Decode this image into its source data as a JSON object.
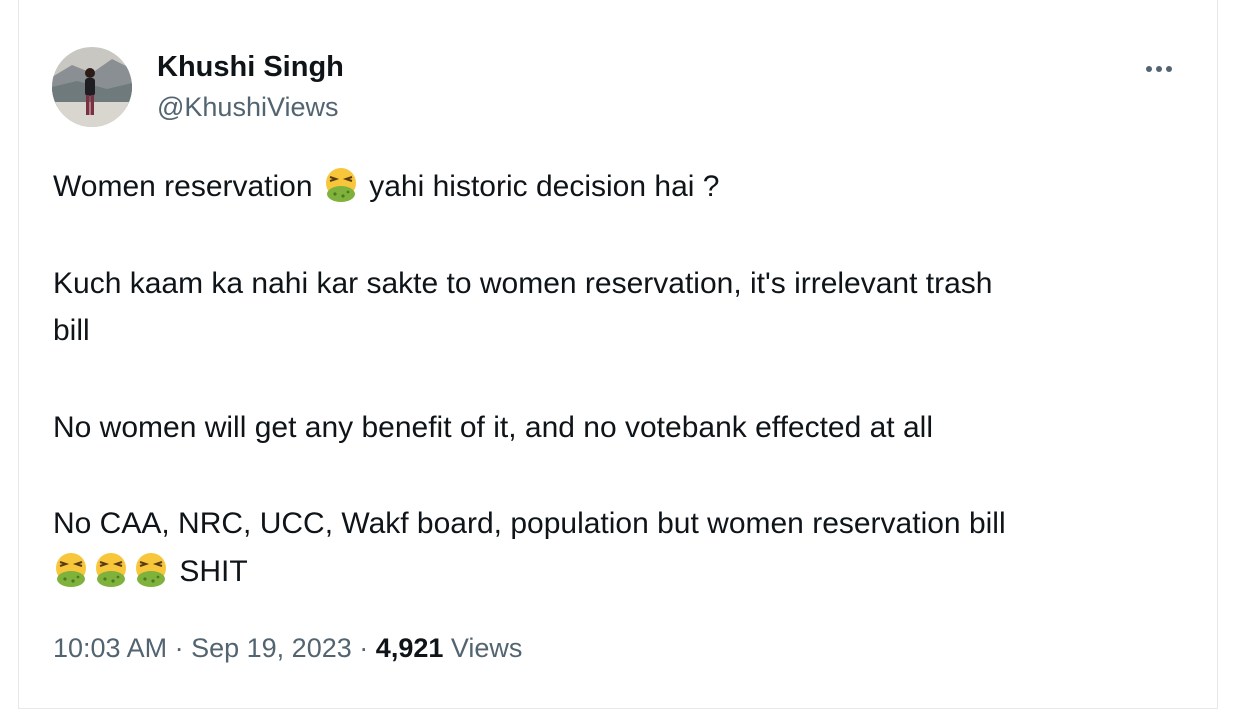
{
  "author": {
    "name": "Khushi Singh",
    "handle": "@KhushiViews"
  },
  "tweet": {
    "line1_before": "Women reservation",
    "line1_after": "yahi historic decision hai ?",
    "line2": "Kuch kaam ka nahi kar sakte to women reservation, it's irrelevant trash",
    "line3": "bill",
    "line4": "No women will get any benefit of it, and no votebank effected at all",
    "line5": "No CAA, NRC, UCC, Wakf board, population but women reservation bill",
    "line6_after": "SHIT"
  },
  "meta": {
    "time": "10:03 AM",
    "sep": "·",
    "date": "Sep 19, 2023",
    "views_count": "4,921",
    "views_label": "Views"
  },
  "icons": {
    "emoji": "vomiting-face-icon",
    "more": "more-dots-icon"
  }
}
